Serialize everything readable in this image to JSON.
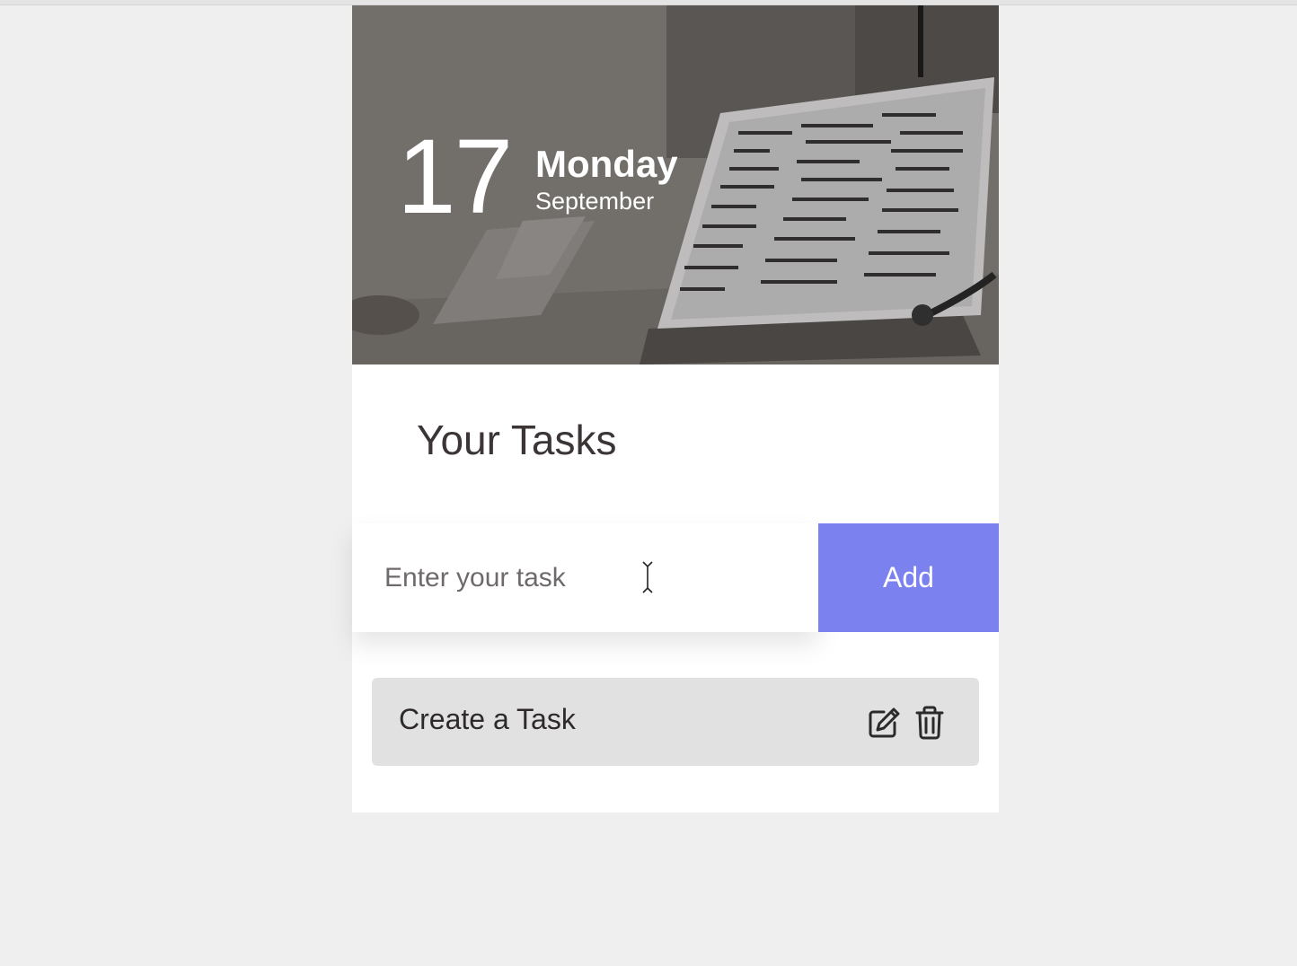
{
  "header": {
    "day_number": "17",
    "weekday": "Monday",
    "month": "September"
  },
  "tasks_section": {
    "title": "Your Tasks",
    "input": {
      "placeholder": "Enter your task",
      "value": ""
    },
    "add_label": "Add",
    "items": [
      {
        "label": "Create a Task",
        "edit_icon": "edit-icon",
        "delete_icon": "trash-icon"
      }
    ]
  },
  "colors": {
    "accent": "#7b81ee",
    "task_item_bg": "#e1e1e1",
    "page_bg": "#efefef"
  }
}
